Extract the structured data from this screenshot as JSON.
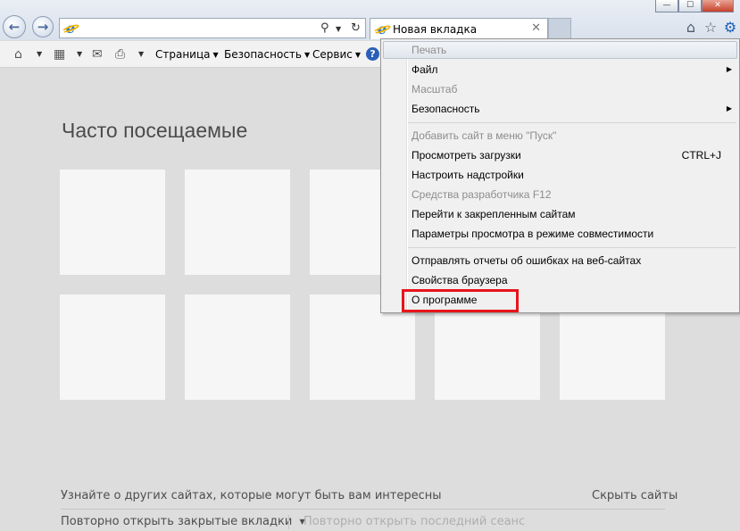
{
  "window": {
    "controls": {
      "minimize": "—",
      "maximize": "☐",
      "close": "✕"
    }
  },
  "address_bar": {
    "value": "",
    "icons": [
      "search-icon",
      "dropdown-icon",
      "refresh-icon"
    ]
  },
  "tab": {
    "label": "Новая вкладка",
    "close": "✕"
  },
  "right_icons": [
    "home-icon",
    "favorites-star-icon",
    "tools-gear-icon"
  ],
  "command_bar": {
    "items": [
      {
        "label": "Страница"
      },
      {
        "label": "Безопасность"
      },
      {
        "label": "Сервис"
      }
    ],
    "help": "?"
  },
  "content": {
    "title": "Часто посещаемые",
    "discover_link": "Узнайте о других сайтах, которые могут быть вам интересны",
    "hide_sites": "Скрыть сайты",
    "reopen_closed_tabs": "Повторно открыть закрытые вкладки",
    "reopen_last_session": "Повторно открыть последний сеанс"
  },
  "menu": {
    "items": [
      {
        "label": "Печать",
        "state": "disabled-highlighted"
      },
      {
        "label": "Файл",
        "submenu": true
      },
      {
        "label": "Масштаб",
        "state": "disabled"
      },
      {
        "label": "Безопасность",
        "submenu": true
      },
      {
        "label": "Добавить сайт в меню \"Пуск\"",
        "state": "disabled"
      },
      {
        "label": "Просмотреть загрузки",
        "shortcut": "CTRL+J"
      },
      {
        "label": "Настроить надстройки"
      },
      {
        "label": "Средства разработчика F12",
        "state": "disabled"
      },
      {
        "label": "Перейти к закрепленным сайтам"
      },
      {
        "label": "Параметры просмотра в режиме совместимости"
      },
      {
        "label": "Отправлять отчеты об ошибках на веб-сайтах"
      },
      {
        "label": "Свойства браузера"
      },
      {
        "label": "О программе",
        "annotated": true
      }
    ]
  },
  "colors": {
    "annotation_red": "#e8141c",
    "content_bg": "#dddddd",
    "tile_bg": "#f6f6f6"
  }
}
